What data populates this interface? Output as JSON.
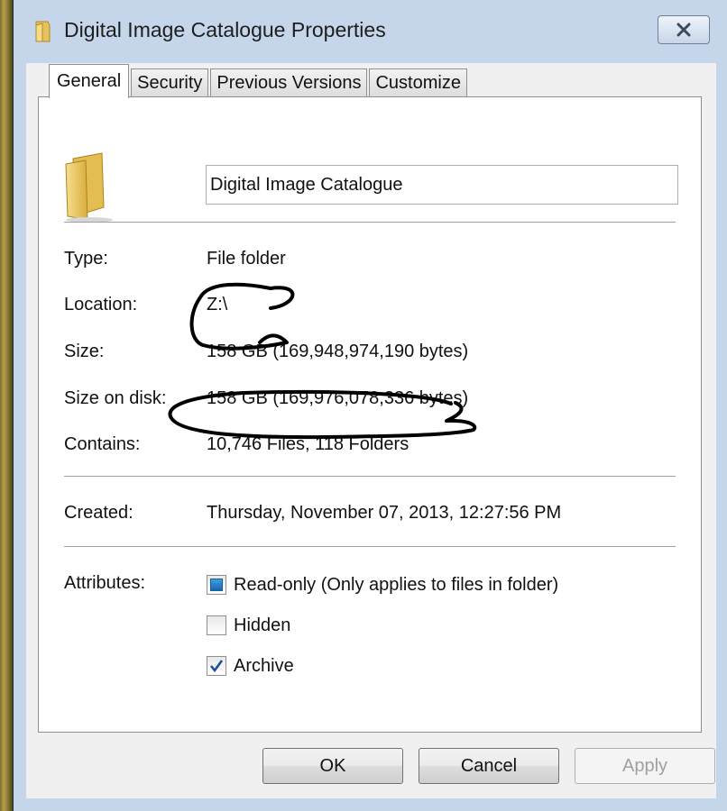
{
  "window": {
    "title": "Digital Image Catalogue Properties"
  },
  "tabs": [
    "General",
    "Security",
    "Previous Versions",
    "Customize"
  ],
  "general": {
    "name_value": "Digital Image Catalogue",
    "rows": {
      "type": {
        "label": "Type:",
        "value": "File folder"
      },
      "location": {
        "label": "Location:",
        "value": "Z:\\"
      },
      "size": {
        "label": "Size:",
        "value": "158 GB (169,948,974,190 bytes)"
      },
      "size_on_disk": {
        "label": "Size on disk:",
        "value": "158 GB (169,976,078,336 bytes)"
      },
      "contains": {
        "label": "Contains:",
        "value": "10,746 Files, 118 Folders"
      },
      "created": {
        "label": "Created:",
        "value": "Thursday, November 07, 2013, 12:27:56 PM"
      }
    },
    "attributes": {
      "label": "Attributes:",
      "read_only": {
        "label": "Read-only (Only applies to files in folder)",
        "state": "indeterminate"
      },
      "hidden": {
        "label": "Hidden",
        "state": "unchecked"
      },
      "archive": {
        "label": "Archive",
        "state": "checked"
      }
    }
  },
  "buttons": {
    "ok": "OK",
    "cancel": "Cancel",
    "apply": "Apply",
    "apply_enabled": false
  },
  "icons": {
    "title": "folder-icon",
    "close": "close-icon",
    "large": "folder-icon"
  },
  "colors": {
    "window_frame": "#c5d5ea",
    "checkbox_indeterminate": "#1b66b0"
  }
}
